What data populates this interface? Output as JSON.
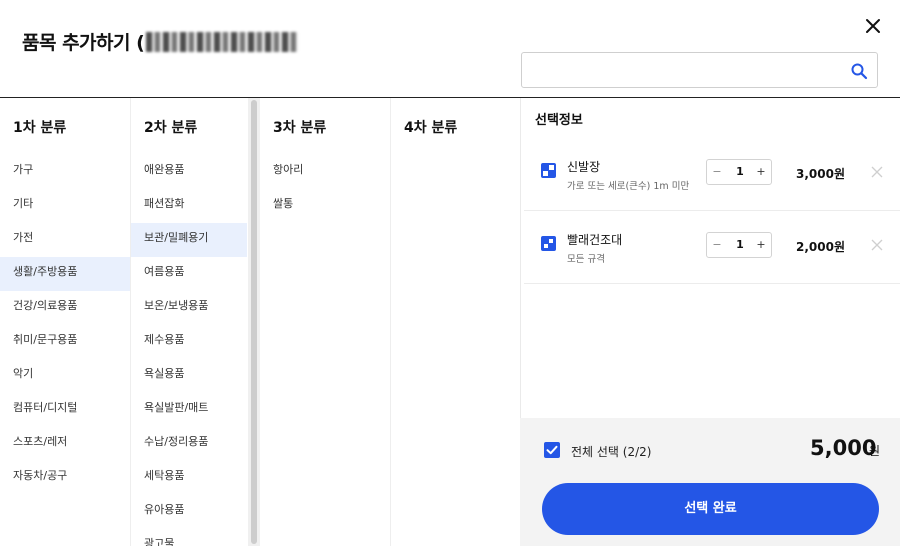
{
  "header": {
    "title": "품목 추가하기 (",
    "close_icon": "close-icon",
    "search": {
      "value": "",
      "placeholder": "",
      "icon": "search-icon"
    }
  },
  "columns": {
    "col1": {
      "title": "1차 분류",
      "items": [
        "가구",
        "기타",
        "가전",
        "생활/주방용품",
        "건강/의료용품",
        "취미/문구용품",
        "악기",
        "컴퓨터/디지털",
        "스포츠/레저",
        "자동차/공구"
      ],
      "selected": "생활/주방용품"
    },
    "col2": {
      "title": "2차 분류",
      "items": [
        "애완용품",
        "패션잡화",
        "보관/밀폐용기",
        "여름용품",
        "보온/보냉용품",
        "제수용품",
        "욕실용품",
        "욕실발판/매트",
        "수납/정리용품",
        "세탁용품",
        "유아용품",
        "광고물"
      ],
      "selected": "보관/밀폐용기"
    },
    "col3": {
      "title": "3차 분류",
      "items": [
        "항아리",
        "쌀통"
      ]
    },
    "col4": {
      "title": "4차 분류",
      "items": []
    }
  },
  "selection": {
    "title": "선택정보",
    "items": [
      {
        "name": "신발장",
        "desc": "가로 또는 세로(큰수) 1m 미만",
        "qty": "1",
        "price": "3,000원",
        "minus": "−",
        "plus": "+"
      },
      {
        "name": "빨래건조대",
        "desc": "모든 규격",
        "qty": "1",
        "price": "2,000원",
        "minus": "−",
        "plus": "+"
      }
    ]
  },
  "footer": {
    "select_all_label": "전체 선택 (2/2)",
    "select_all_checked": true,
    "total": "5,000",
    "currency": "원",
    "done_label": "선택 완료"
  },
  "colors": {
    "accent": "#2456e6",
    "selected_bg": "#e9f0fd",
    "footer_bg": "#f3f3f3"
  }
}
